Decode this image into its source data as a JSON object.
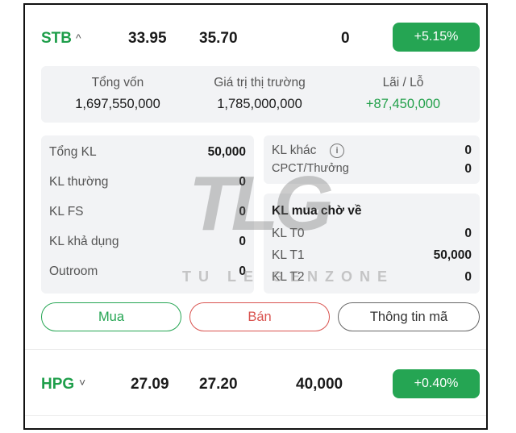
{
  "stock1": {
    "symbol": "STB",
    "chevron": "^",
    "price1": "33.95",
    "price2": "35.70",
    "qty": "0",
    "change": "+5.15%",
    "summary": {
      "total_capital_label": "Tổng vốn",
      "total_capital_value": "1,697,550,000",
      "market_value_label": "Giá trị thị trường",
      "market_value_value": "1,785,000,000",
      "pnl_label": "Lãi / Lỗ",
      "pnl_value": "+87,450,000"
    },
    "left_panel": [
      {
        "label": "Tổng KL",
        "value": "50,000"
      },
      {
        "label": "KL thường",
        "value": "0"
      },
      {
        "label": "KL FS",
        "value": "0"
      },
      {
        "label": "KL khả dụng",
        "value": "0"
      },
      {
        "label": "Outroom",
        "value": "0"
      }
    ],
    "right_top_panel": [
      {
        "label": "KL khác",
        "value": "0"
      },
      {
        "label": "CPCT/Thưởng",
        "value": "0"
      }
    ],
    "pending": {
      "title": "KL mua chờ về",
      "rows": [
        {
          "label": "KL T0",
          "value": "0"
        },
        {
          "label": "KL T1",
          "value": "50,000"
        },
        {
          "label": "KL T2",
          "value": "0"
        }
      ]
    },
    "buttons": {
      "buy": "Mua",
      "sell": "Bán",
      "info": "Thông tin mã"
    }
  },
  "stock2": {
    "symbol": "HPG",
    "chevron": "˅",
    "price1": "27.09",
    "price2": "27.20",
    "qty": "40,000",
    "change": "+0.40%"
  },
  "watermark": {
    "letters": "TLG",
    "text": "TU LE GENZONE"
  },
  "colors": {
    "accent_green": "#25a553",
    "sell_red": "#d9534f",
    "panel_bg": "#f2f3f5"
  },
  "icons": {
    "info": "info-circle-icon",
    "chevron_up": "chevron-up-icon",
    "chevron_down": "chevron-down-icon"
  }
}
